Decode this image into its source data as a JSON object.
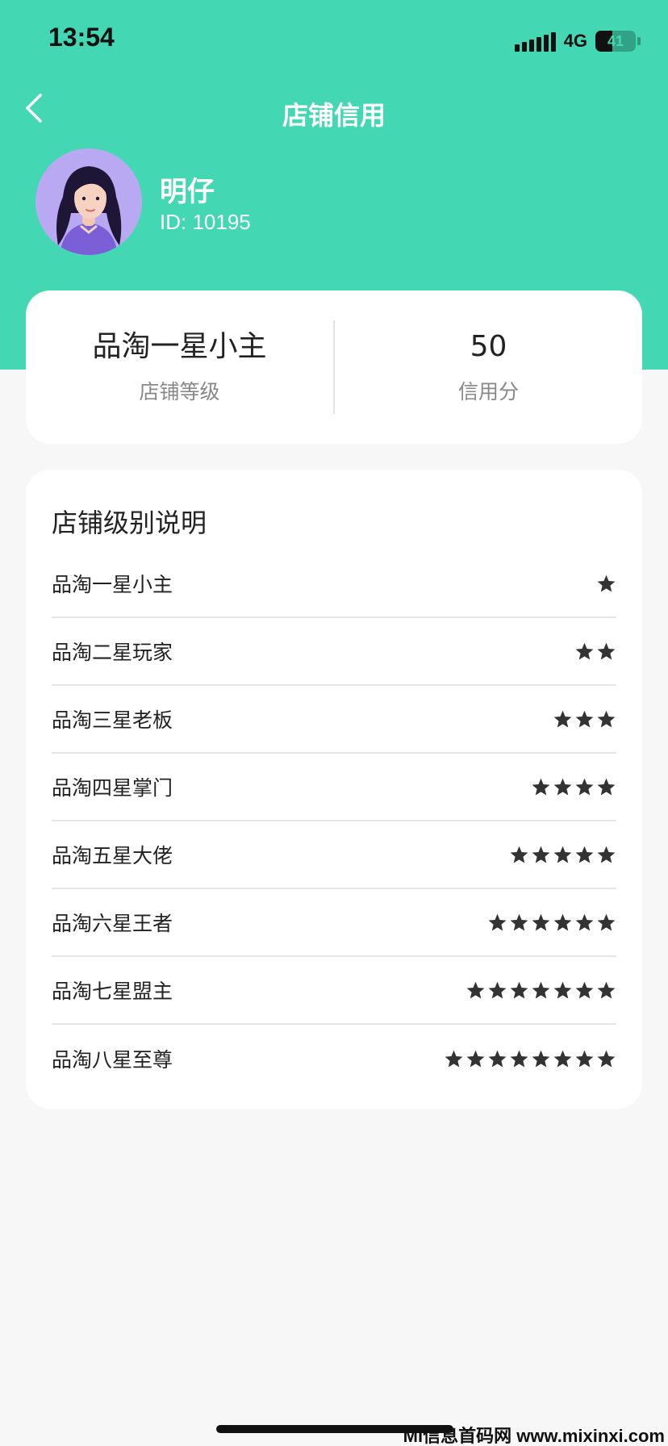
{
  "status_bar": {
    "time": "13:54",
    "network": "4G",
    "battery_text": "41",
    "battery_level": 0.41
  },
  "nav": {
    "title": "店铺信用",
    "back_icon": "chevron-left-icon"
  },
  "user": {
    "name": "明仔",
    "id_text": "ID: 10195",
    "avatar_icon": "avatar-woman-illustration"
  },
  "summary": {
    "level_value": "品淘一星小主",
    "level_label": "店铺等级",
    "credit_value": "50",
    "credit_label": "信用分"
  },
  "levels_section": {
    "title": "店铺级别说明",
    "items": [
      {
        "name": "品淘一星小主",
        "stars": 1
      },
      {
        "name": "品淘二星玩家",
        "stars": 2
      },
      {
        "name": "品淘三星老板",
        "stars": 3
      },
      {
        "name": "品淘四星掌门",
        "stars": 4
      },
      {
        "name": "品淘五星大佬",
        "stars": 5
      },
      {
        "name": "品淘六星王者",
        "stars": 6
      },
      {
        "name": "品淘七星盟主",
        "stars": 7
      },
      {
        "name": "品淘八星至尊",
        "stars": 8
      }
    ]
  },
  "watermark": "Mi信息首码网 www.mixinxi.com",
  "colors": {
    "primary": "#43d8b3",
    "background": "#f7f7f7",
    "card": "#ffffff",
    "star": "#333333"
  }
}
